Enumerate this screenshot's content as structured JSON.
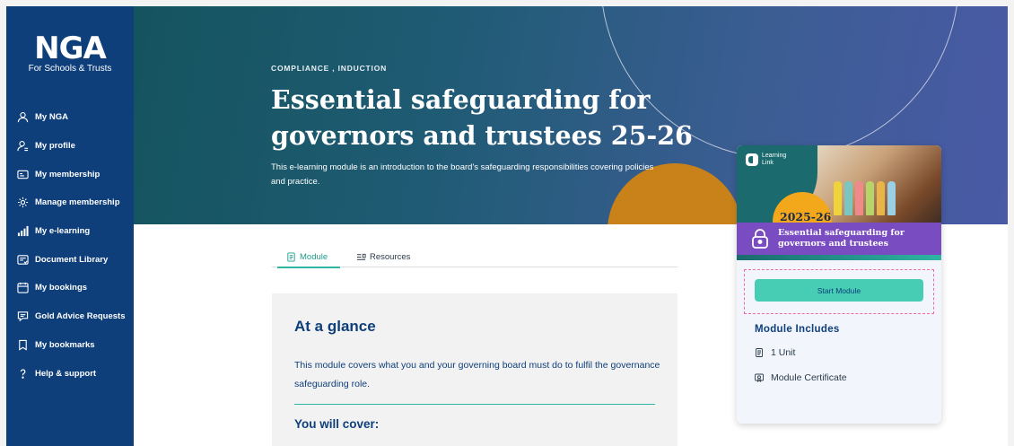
{
  "sidebar": {
    "logo_mark": "NGA",
    "logo_sub": "For Schools & Trusts",
    "items": [
      {
        "label": "My NGA",
        "icon": "user-icon"
      },
      {
        "label": "My profile",
        "icon": "profile-icon"
      },
      {
        "label": "My membership",
        "icon": "id-card-icon"
      },
      {
        "label": "Manage membership",
        "icon": "gear-icon"
      },
      {
        "label": "My e-learning",
        "icon": "bar-chart-icon"
      },
      {
        "label": "Document Library",
        "icon": "document-icon"
      },
      {
        "label": "My bookings",
        "icon": "calendar-icon"
      },
      {
        "label": "Gold Advice Requests",
        "icon": "chat-icon"
      },
      {
        "label": "My bookmarks",
        "icon": "bookmark-icon"
      },
      {
        "label": "Help & support",
        "icon": "question-icon"
      }
    ]
  },
  "hero": {
    "category": "COMPLIANCE , INDUCTION",
    "title": "Essential safeguarding for governors and trustees 25-26",
    "description": "This e-learning module is an introduction to the board's safeguarding responsibilities covering policies and practice."
  },
  "tabs": [
    {
      "label": "Module",
      "active": true
    },
    {
      "label": "Resources",
      "active": false
    }
  ],
  "content": {
    "heading": "At a glance",
    "description": "This module covers what you and your governing board must do to fulfil the governance safeguarding role.",
    "cover_heading": "You will cover:"
  },
  "card": {
    "brand": "Learning Link",
    "year": "2025-26",
    "thumb_title": "Essential safeguarding for governors and trustees",
    "start_label": "Start Module",
    "includes_title": "Module Includes",
    "includes": [
      {
        "label": "1 Unit",
        "icon": "unit-icon"
      },
      {
        "label": "Module Certificate",
        "icon": "certificate-icon"
      }
    ]
  },
  "colors": {
    "sidebar": "#0e3f7b",
    "accent": "#48cdb5",
    "purple": "#7a4cc2",
    "orange": "#f3a81c"
  }
}
